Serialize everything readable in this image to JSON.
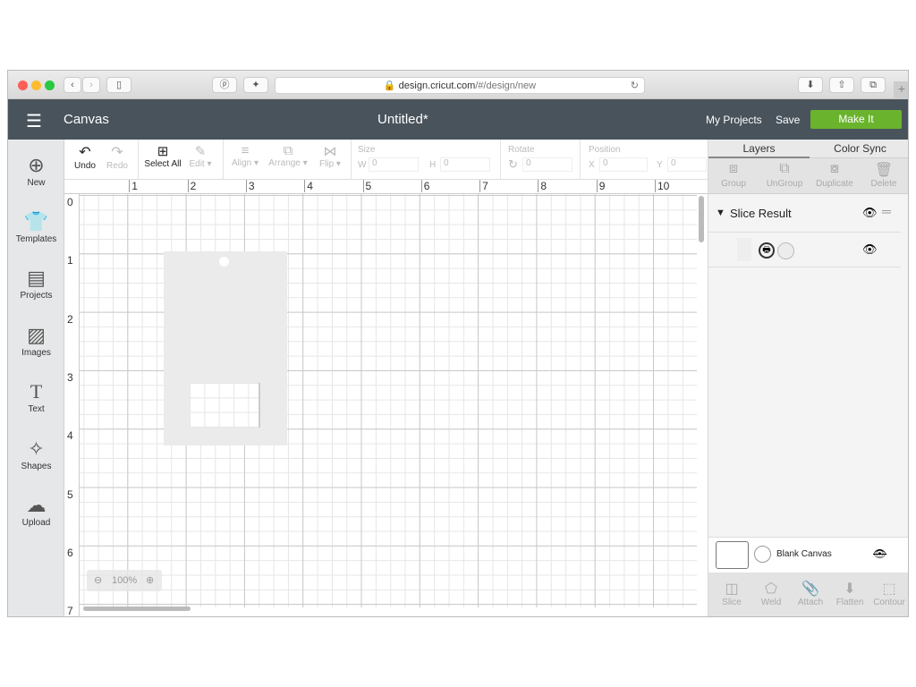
{
  "browser": {
    "url_host": "design.cricut.com",
    "url_path": "/#/design/new"
  },
  "header": {
    "section": "Canvas",
    "title": "Untitled*",
    "my_projects": "My Projects",
    "save": "Save",
    "make_it": "Make It",
    "accent": "#6ab42d"
  },
  "sidebar": {
    "items": [
      {
        "label": "New",
        "icon": "plus-circle-icon"
      },
      {
        "label": "Templates",
        "icon": "shirt-icon"
      },
      {
        "label": "Projects",
        "icon": "notebook-icon"
      },
      {
        "label": "Images",
        "icon": "image-icon"
      },
      {
        "label": "Text",
        "icon": "text-icon"
      },
      {
        "label": "Shapes",
        "icon": "shapes-icon"
      },
      {
        "label": "Upload",
        "icon": "cloud-upload-icon"
      }
    ]
  },
  "toolbar": {
    "undo": "Undo",
    "redo": "Redo",
    "select_all": "Select All",
    "edit": "Edit",
    "align": "Align",
    "arrange": "Arrange",
    "flip": "Flip",
    "size": "Size",
    "w": "W",
    "h": "H",
    "w_value": "0",
    "h_value": "0",
    "rotate": "Rotate",
    "rotate_value": "0",
    "position": "Position",
    "x": "X",
    "y": "Y",
    "x_value": "0",
    "y_value": "0"
  },
  "ruler": {
    "top": [
      "1",
      "2",
      "3",
      "4",
      "5",
      "6",
      "7",
      "8",
      "9",
      "10"
    ],
    "left": [
      "0",
      "1",
      "2",
      "3",
      "4",
      "5",
      "6",
      "7"
    ]
  },
  "zoom": {
    "level": "100%"
  },
  "panel": {
    "tabs": [
      "Layers",
      "Color Sync"
    ],
    "actions": [
      "Group",
      "UnGroup",
      "Duplicate",
      "Delete"
    ],
    "layer_group": "Slice Result",
    "blank_canvas": "Blank Canvas",
    "bottom_actions": [
      "Slice",
      "Weld",
      "Attach",
      "Flatten",
      "Contour"
    ]
  }
}
